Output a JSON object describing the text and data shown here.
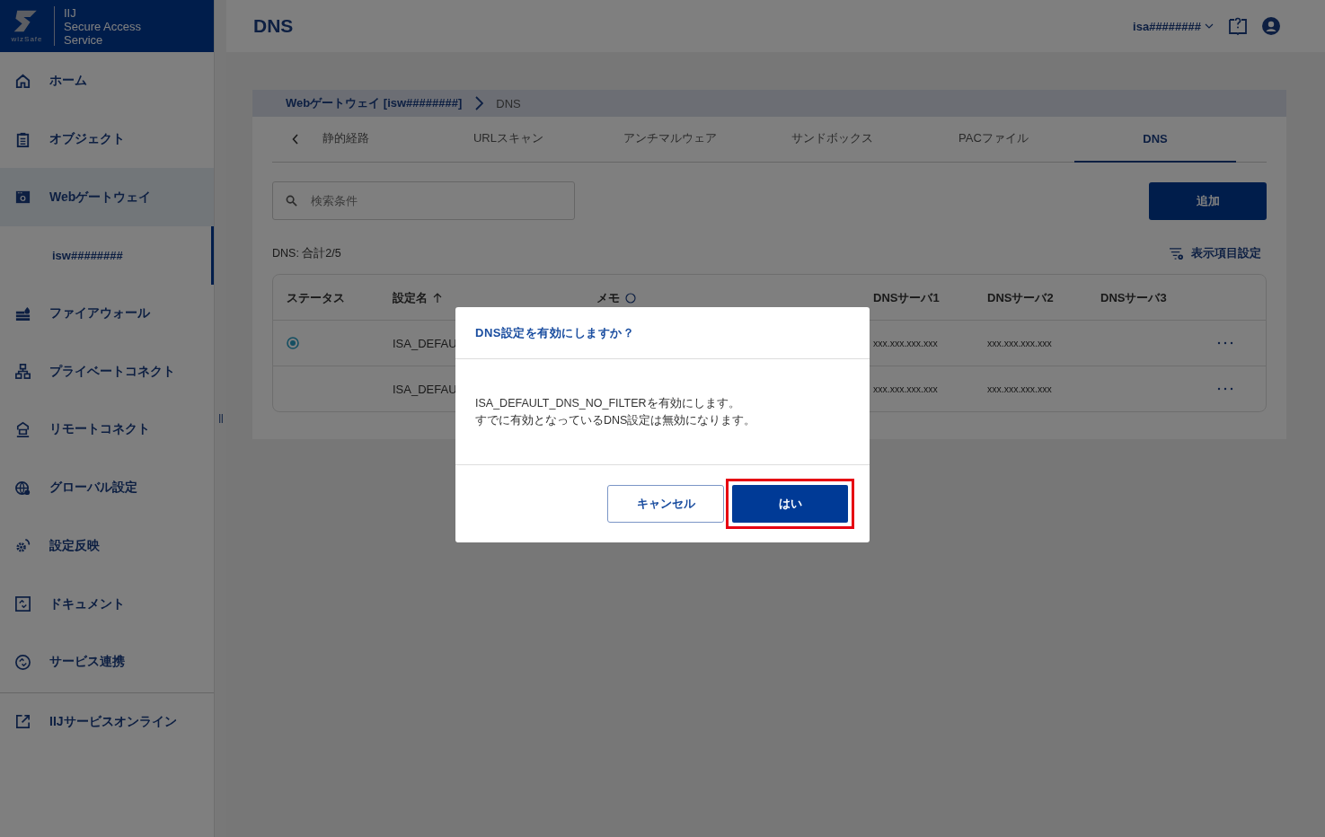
{
  "brand": {
    "logo_text": "wizSafe",
    "product": [
      "IIJ",
      "Secure Access",
      "Service"
    ]
  },
  "sidebar": {
    "items": [
      {
        "label": "ホーム",
        "selected": false
      },
      {
        "label": "オブジェクト",
        "selected": false
      },
      {
        "label": "Webゲートウェイ",
        "selected": true,
        "children": [
          {
            "label": "isw########",
            "selected": true
          }
        ]
      },
      {
        "label": "ファイアウォール",
        "selected": false
      },
      {
        "label": "プライベートコネクト",
        "selected": false
      },
      {
        "label": "リモートコネクト",
        "selected": false
      },
      {
        "label": "グローバル設定",
        "selected": false
      },
      {
        "label": "設定反映",
        "selected": false
      },
      {
        "label": "ドキュメント",
        "selected": false
      },
      {
        "label": "サービス連携",
        "selected": false
      }
    ],
    "footer_link": "IIJサービスオンライン"
  },
  "header": {
    "title": "DNS",
    "account": "isa########"
  },
  "breadcrumb": [
    {
      "label": "Webゲートウェイ [isw########]",
      "link": true
    },
    {
      "label": "DNS",
      "link": false
    }
  ],
  "tabs": [
    {
      "label": "静的経路",
      "selected": false
    },
    {
      "label": "URLスキャン",
      "selected": false
    },
    {
      "label": "アンチマルウェア",
      "selected": false
    },
    {
      "label": "サンドボックス",
      "selected": false
    },
    {
      "label": "PACファイル",
      "selected": false
    },
    {
      "label": "DNS",
      "selected": true
    }
  ],
  "search": {
    "placeholder": "検索条件"
  },
  "add_button": "追加",
  "count": "DNS: 合計2/5",
  "column_settings": "表示項目設定",
  "table": {
    "columns": [
      "ステータス",
      "設定名",
      "メモ",
      "DNSサーバ1",
      "DNSサーバ2",
      "DNSサーバ3"
    ],
    "rows": [
      {
        "active": true,
        "name": "ISA_DEFAU",
        "dns1": "xxx.xxx.xxx.xxx",
        "dns2": "xxx.xxx.xxx.xxx"
      },
      {
        "active": false,
        "name": "ISA_DEFAU",
        "dns1": "xxx.xxx.xxx.xxx",
        "dns2": "xxx.xxx.xxx.xxx"
      }
    ]
  },
  "dialog": {
    "title": "DNS設定を有効にしますか？",
    "message": [
      "ISA_DEFAULT_DNS_NO_FILTERを有効にします。",
      "すでに有効となっているDNS設定は無効になります。"
    ],
    "cancel": "キャンセル",
    "confirm": "はい",
    "confirm_highlighted": true
  }
}
